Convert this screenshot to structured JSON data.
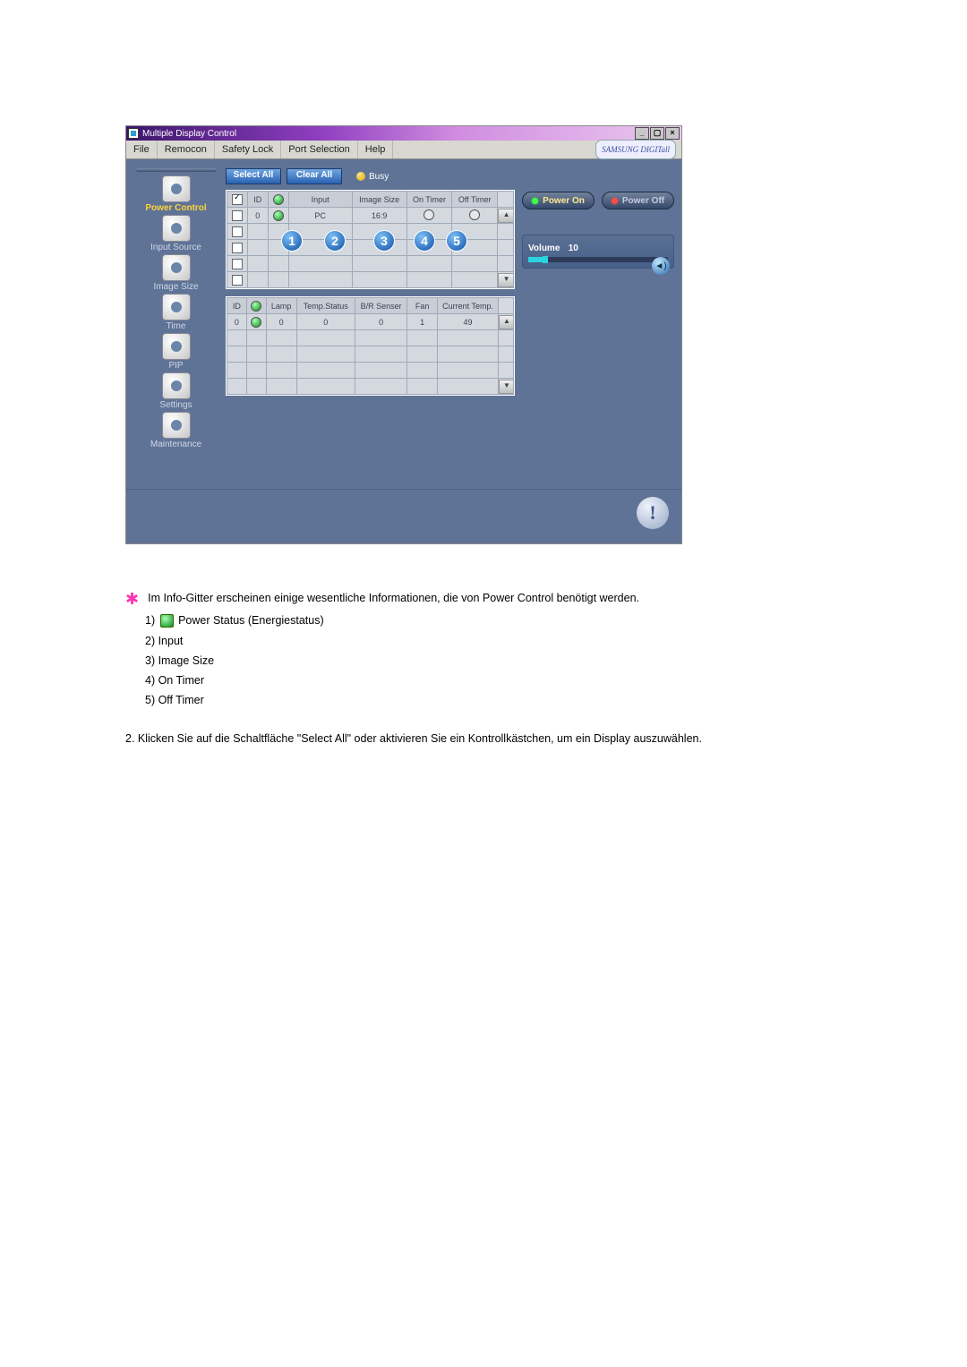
{
  "window": {
    "title": "Multiple Display Control"
  },
  "menu": [
    "File",
    "Remocon",
    "Safety Lock",
    "Port Selection",
    "Help"
  ],
  "brand": "SAMSUNG DIGITall",
  "sidebar": [
    {
      "label": "Power Control",
      "active": true,
      "icon": "power"
    },
    {
      "label": "Input Source",
      "icon": "input"
    },
    {
      "label": "Image Size",
      "icon": "image"
    },
    {
      "label": "Time",
      "icon": "time"
    },
    {
      "label": "PIP",
      "icon": "pip"
    },
    {
      "label": "Settings",
      "icon": "settings"
    },
    {
      "label": "Maintenance",
      "icon": "maint"
    }
  ],
  "topButtons": {
    "selectAll": "Select All",
    "clearAll": "Clear All",
    "busy": "Busy"
  },
  "grid1": {
    "headers": [
      "",
      "ID",
      "",
      "Input",
      "Image Size",
      "On Timer",
      "Off Timer"
    ],
    "rows": [
      {
        "chk": false,
        "id": "0",
        "pw": "green",
        "input": "PC",
        "imgsize": "16:9",
        "ontimer": "ring",
        "offtimer": "ring"
      },
      {
        "chk": false,
        "id": "",
        "pw": "",
        "input": "",
        "imgsize": "",
        "ontimer": "",
        "offtimer": ""
      },
      {
        "chk": false,
        "id": "",
        "pw": "",
        "input": "",
        "imgsize": "",
        "ontimer": "",
        "offtimer": ""
      },
      {
        "chk": false,
        "id": "",
        "pw": "",
        "input": "",
        "imgsize": "",
        "ontimer": "",
        "offtimer": ""
      },
      {
        "chk": false,
        "id": "",
        "pw": "",
        "input": "",
        "imgsize": "",
        "ontimer": "",
        "offtimer": ""
      }
    ],
    "callouts": [
      "1",
      "2",
      "3",
      "4",
      "5"
    ]
  },
  "grid2": {
    "headers": [
      "ID",
      "",
      "Lamp",
      "Temp.Status",
      "B/R Senser",
      "Fan",
      "Current Temp."
    ],
    "rows": [
      {
        "id": "0",
        "pw": "green",
        "lamp": "0",
        "temp": "0",
        "br": "0",
        "fan": "1",
        "ct": "49"
      },
      {
        "id": "",
        "pw": "",
        "lamp": "",
        "temp": "",
        "br": "",
        "fan": "",
        "ct": ""
      },
      {
        "id": "",
        "pw": "",
        "lamp": "",
        "temp": "",
        "br": "",
        "fan": "",
        "ct": ""
      },
      {
        "id": "",
        "pw": "",
        "lamp": "",
        "temp": "",
        "br": "",
        "fan": "",
        "ct": ""
      },
      {
        "id": "",
        "pw": "",
        "lamp": "",
        "temp": "",
        "br": "",
        "fan": "",
        "ct": ""
      }
    ]
  },
  "right": {
    "powerOn": "Power On",
    "powerOff": "Power Off",
    "volumeLabel": "Volume",
    "volumeValue": "10"
  },
  "doc": {
    "intro": "Im Info-Gitter erscheinen einige wesentliche Informationen, die von Power Control benötigt werden.",
    "items": [
      "Power Status (Energiestatus)",
      "Input",
      "Image Size",
      "On Timer",
      "Off Timer"
    ],
    "step2": "2.  Klicken Sie auf die Schaltfläche \"Select All\" oder aktivieren Sie ein Kontrollkästchen, um ein Display auszuwählen."
  }
}
